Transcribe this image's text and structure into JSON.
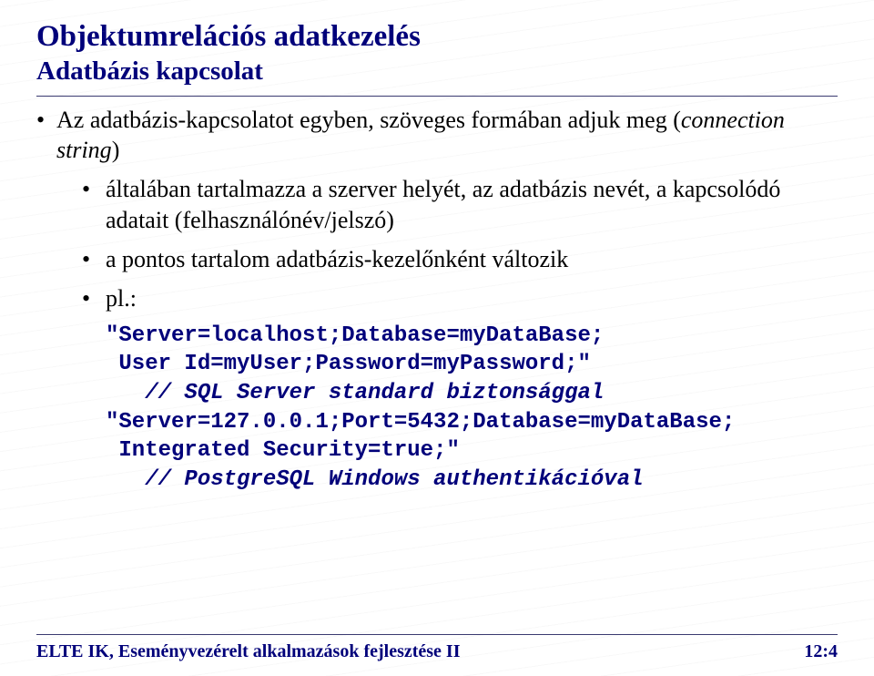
{
  "title": "Objektumrelációs adatkezelés",
  "subtitle": "Adatbázis kapcsolat",
  "bullets": {
    "main": "Az adatbázis-kapcsolatot egyben, szöveges formában adjuk meg (",
    "main_italic": "connection string",
    "main_close": ")",
    "sub1": "általában tartalmazza a szerver helyét, az adatbázis nevét, a kapcsolódó adatait (felhasználónév/jelszó)",
    "sub2": "a pontos tartalom adatbázis-kezelőnként változik",
    "sub3": "pl.:"
  },
  "code": {
    "line1": "\"Server=localhost;Database=myDataBase;",
    "line2": " User Id=myUser;Password=myPassword;\"",
    "line3": "   // SQL Server standard biztonsággal",
    "line4": "\"Server=127.0.0.1;Port=5432;Database=myDataBase;",
    "line5": " Integrated Security=true;\"",
    "line6": "   // PostgreSQL Windows authentikációval"
  },
  "footer": {
    "left": "ELTE IK, Eseményvezérelt alkalmazások fejlesztése II",
    "right": "12:4"
  }
}
